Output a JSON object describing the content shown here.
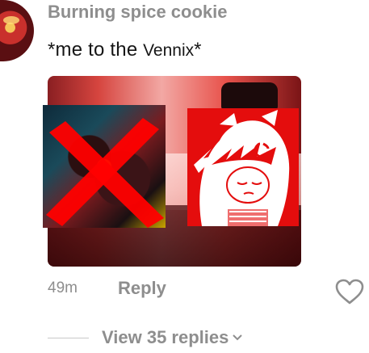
{
  "comment": {
    "username": "Burning spice cookie",
    "text_before": "*me to the",
    "text_highlight": "Vennix",
    "text_after": "*",
    "time": "49m",
    "reply_label": "Reply",
    "view_replies_label": "View 35 replies"
  },
  "icons": {
    "like": "heart-outline-icon",
    "expand": "chevron-down-icon",
    "reject": "red-x-icon",
    "angry": "anger-symbol-icon"
  },
  "colors": {
    "username": "#8e8e8e",
    "text": "#161616",
    "meta": "#8e8e8e",
    "cross": "#ff0000",
    "art_red": "#e40d0d"
  }
}
